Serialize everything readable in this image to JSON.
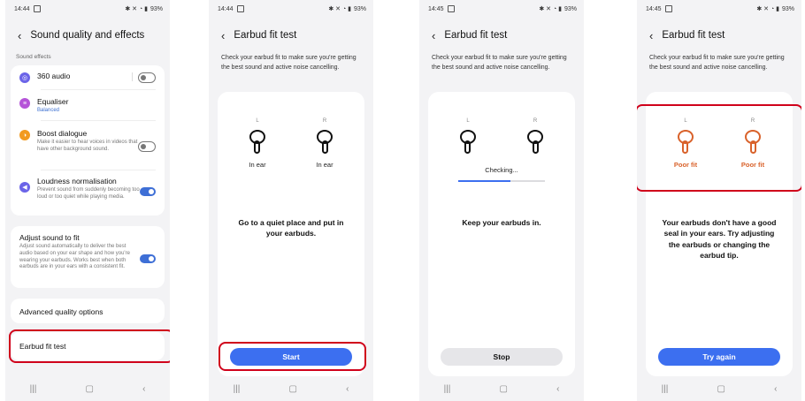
{
  "panels": [
    {
      "status": {
        "time": "14:44",
        "battery": "93%"
      },
      "title": "Sound quality and effects",
      "section_label": "Sound effects",
      "items": [
        {
          "label": "360 audio",
          "toggle": "off",
          "icon": "surround-icon",
          "color": "#6b64e8"
        },
        {
          "label": "Equaliser",
          "sub": "Balanced",
          "icon": "equaliser-icon",
          "color": "#b554d8"
        },
        {
          "label": "Boost dialogue",
          "sub": "Make it easier to hear voices in videos that have other background sound.",
          "toggle": "off",
          "icon": "dialogue-icon",
          "color": "#f29a1f"
        },
        {
          "label": "Loudness normalisation",
          "sub": "Prevent sound from suddenly becoming too loud or too quiet while playing media.",
          "toggle": "on",
          "icon": "loudness-icon",
          "color": "#6b64e8"
        }
      ],
      "adjust": {
        "label": "Adjust sound to fit",
        "sub": "Adjust sound automatically to deliver the best audio based on your ear shape and how you're wearing your earbuds. Works best when both earbuds are in your ears with a consistent fit.",
        "toggle": "on"
      },
      "advanced_label": "Advanced quality options",
      "fit_test_label": "Earbud fit test"
    },
    {
      "status": {
        "time": "14:44",
        "battery": "93%"
      },
      "title": "Earbud fit test",
      "description": "Check your earbud fit to make sure you're getting the best sound and active noise cancelling.",
      "left_label": "L",
      "right_label": "R",
      "left_status": "In ear",
      "right_status": "In ear",
      "message": "Go to a quiet place and put in your earbuds.",
      "button": "Start"
    },
    {
      "status": {
        "time": "14:45",
        "battery": "93%"
      },
      "title": "Earbud fit test",
      "description": "Check your earbud fit to make sure you're getting the best sound and active noise cancelling.",
      "left_label": "L",
      "right_label": "R",
      "checking": "Checking...",
      "progress": 0.6,
      "message": "Keep your earbuds in.",
      "button": "Stop"
    },
    {
      "status": {
        "time": "14:45",
        "battery": "93%"
      },
      "title": "Earbud fit test",
      "description": "Check your earbud fit to make sure you're getting the best sound and active noise cancelling.",
      "left_label": "L",
      "right_label": "R",
      "left_status": "Poor fit",
      "right_status": "Poor fit",
      "message": "Your earbuds don't have a good seal in your ears. Try adjusting the earbuds or changing the earbud tip.",
      "button": "Try again"
    }
  ],
  "colors": {
    "accent": "#3c6ff0",
    "highlight": "#d0021b",
    "poor_fit": "#d9622b"
  }
}
